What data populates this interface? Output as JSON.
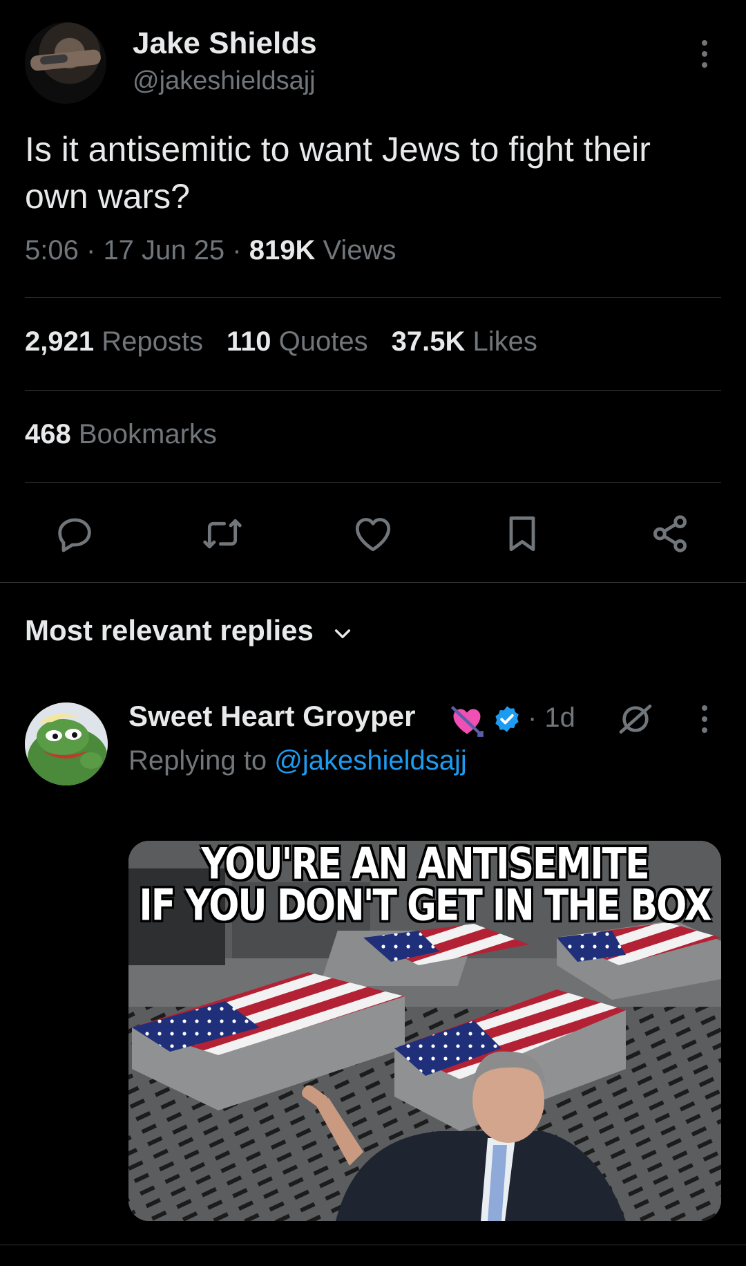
{
  "tweet": {
    "author_name": "Jake Shields",
    "author_handle": "@jakeshieldsajj",
    "text": "Is it antisemitic to want Jews to fight their own wars?",
    "time": "5:06",
    "date": "17 Jun 25",
    "views_count": "819K",
    "views_label": "Views",
    "separator": "·"
  },
  "stats": {
    "reposts_count": "2,921",
    "reposts_label": "Reposts",
    "quotes_count": "110",
    "quotes_label": "Quotes",
    "likes_count": "37.5K",
    "likes_label": "Likes",
    "bookmarks_count": "468",
    "bookmarks_label": "Bookmarks"
  },
  "actions": {
    "icons": [
      "reply-icon",
      "repost-icon",
      "like-icon",
      "bookmark-icon",
      "share-icon"
    ]
  },
  "replies": {
    "sort_label": "Most relevant replies"
  },
  "reply": {
    "author_name": "Sweet Heart Groyper",
    "age": "· 1d",
    "replying_prefix": "Replying to",
    "replying_handle": "@jakeshieldsajj",
    "media_caption_line1": "YOU'RE AN ANTISEMITE",
    "media_caption_line2": "IF YOU DON'T GET IN THE BOX"
  },
  "colors": {
    "background": "#000000",
    "text_primary": "#e7e9ea",
    "text_secondary": "#71767b",
    "link": "#1d9bf0",
    "divider": "#2f3336",
    "verified": "#1d9bf0"
  }
}
